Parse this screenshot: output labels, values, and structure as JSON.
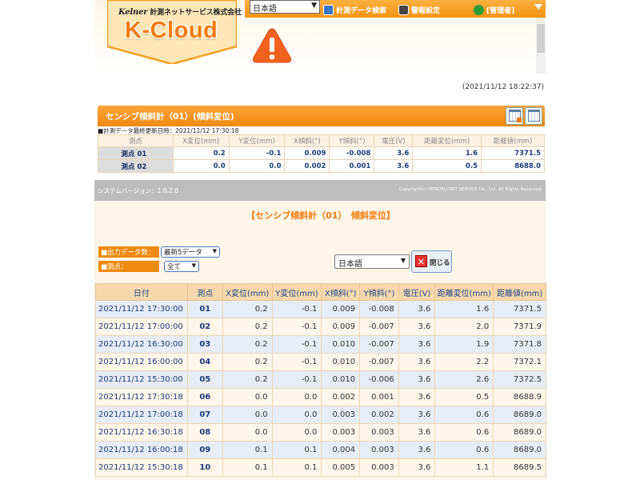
{
  "header": {
    "logo_brand": "Kelner",
    "company": "計測ネットサービス株式会社",
    "logo_text": "K-Cloud",
    "lang_select": "日本語",
    "nav_data_search": "計測データ検索",
    "nav_alarm_settings": "警報設定",
    "nav_user": "[管理者]",
    "timestamp": "(2021/11/12 18:22:37)"
  },
  "summary": {
    "title": "センシブ傾斜計（01）(傾斜変位)",
    "update_note": "■計測データ最終更新日時：2021/11/12 17:30:18",
    "columns": [
      "測点",
      "X変位(mm)",
      "Y変位(mm)",
      "X傾斜(°)",
      "Y傾斜(°)",
      "電圧(V)",
      "距離変位(mm)",
      "距離値(mm)"
    ],
    "rows": [
      [
        "測点 01",
        "0.2",
        "-0.1",
        "0.009",
        "-0.008",
        "3.6",
        "1.6",
        "7371.5"
      ],
      [
        "測点 02",
        "0.0",
        "0.0",
        "0.002",
        "0.001",
        "3.6",
        "0.5",
        "8688.0"
      ]
    ]
  },
  "sysbar": {
    "version": "システムバージョン：1.0.2.0",
    "copyright": "Copyright(c) KEISOKU NET SERVICE Co., Ltd. All Rights Reserved."
  },
  "detail": {
    "title": "【センシブ傾斜計（01）　傾斜変位】",
    "output_count_label": "■出力データ数：",
    "output_count_value": "最新5データ",
    "point_label": "■測点：",
    "point_value": "全て",
    "lang_select": "日本語",
    "close_label": "閉じる",
    "columns": [
      "日付",
      "測点",
      "X変位(mm)",
      "Y変位(mm)",
      "X傾斜(°)",
      "Y傾斜(°)",
      "電圧(V)",
      "距離変位(mm)",
      "距離値(mm)"
    ],
    "rows": [
      [
        "2021/11/12 17:30:00",
        "01",
        "0.2",
        "-0.1",
        "0.009",
        "-0.008",
        "3.6",
        "1.6",
        "7371.5"
      ],
      [
        "2021/11/12 17:00:00",
        "02",
        "0.2",
        "-0.1",
        "0.009",
        "-0.007",
        "3.6",
        "2.0",
        "7371.9"
      ],
      [
        "2021/11/12 16:30:00",
        "03",
        "0.2",
        "-0.1",
        "0.010",
        "-0.007",
        "3.6",
        "1.9",
        "7371.8"
      ],
      [
        "2021/11/12 16:00:00",
        "04",
        "0.2",
        "-0.1",
        "0.010",
        "-0.007",
        "3.6",
        "2.2",
        "7372.1"
      ],
      [
        "2021/11/12 15:30:00",
        "05",
        "0.2",
        "-0.1",
        "0.010",
        "-0.006",
        "3.6",
        "2.6",
        "7372.5"
      ],
      [
        "2021/11/12 17:30:18",
        "06",
        "0.0",
        "0.0",
        "0.002",
        "0.001",
        "3.6",
        "0.5",
        "8688.9"
      ],
      [
        "2021/11/12 17:00:18",
        "07",
        "0.0",
        "0.0",
        "0.003",
        "0.002",
        "3.6",
        "0.6",
        "8689.0"
      ],
      [
        "2021/11/12 16:30:18",
        "08",
        "0.0",
        "0.0",
        "0.003",
        "0.003",
        "3.6",
        "0.6",
        "8689.0"
      ],
      [
        "2021/11/12 16:00:18",
        "09",
        "0.1",
        "0.1",
        "0.004",
        "0.003",
        "3.6",
        "0.6",
        "8689.0"
      ],
      [
        "2021/11/12 15:30:18",
        "10",
        "0.1",
        "0.1",
        "0.005",
        "0.003",
        "3.6",
        "1.1",
        "8689.5"
      ]
    ]
  },
  "colors": {
    "accent_orange": "#f08a10",
    "logo_orange": "#f47a0c",
    "header_blue": "#20478a",
    "row_alt": "#e6edf6"
  },
  "icons": {
    "warning": "warning-triangle-icon",
    "data_search": "data-search-icon",
    "alarm": "alarm-settings-icon",
    "user": "user-icon",
    "close": "close-x-icon",
    "calendar": "calendar-icon"
  }
}
